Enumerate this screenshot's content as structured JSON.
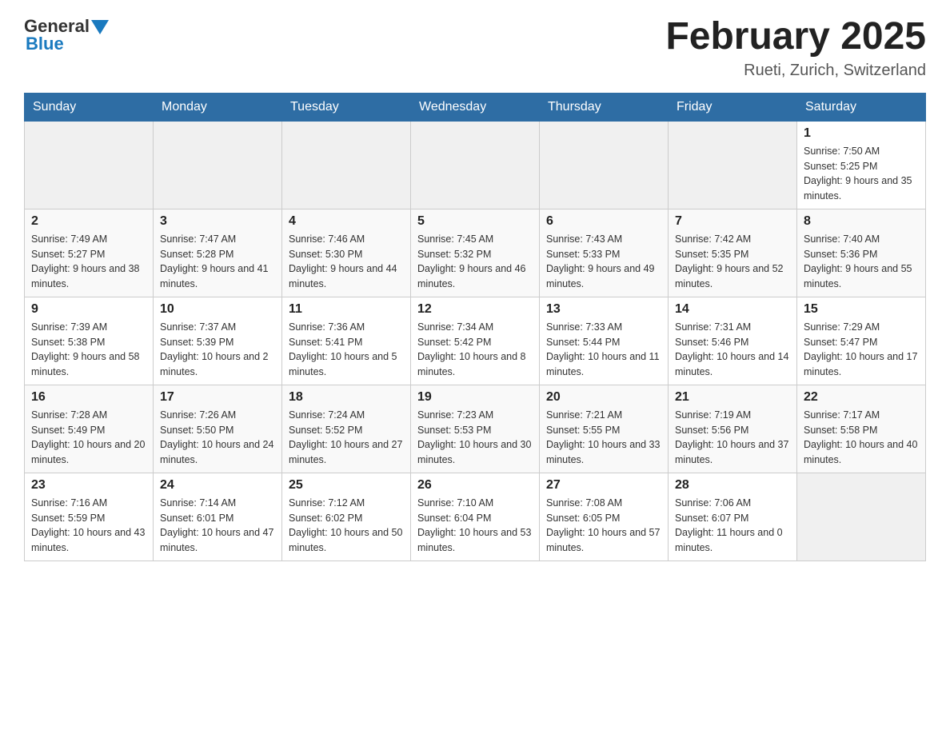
{
  "header": {
    "logo_general": "General",
    "logo_blue": "Blue",
    "title": "February 2025",
    "location": "Rueti, Zurich, Switzerland"
  },
  "days_of_week": [
    "Sunday",
    "Monday",
    "Tuesday",
    "Wednesday",
    "Thursday",
    "Friday",
    "Saturday"
  ],
  "weeks": [
    [
      {
        "day": "",
        "sunrise": "",
        "sunset": "",
        "daylight": ""
      },
      {
        "day": "",
        "sunrise": "",
        "sunset": "",
        "daylight": ""
      },
      {
        "day": "",
        "sunrise": "",
        "sunset": "",
        "daylight": ""
      },
      {
        "day": "",
        "sunrise": "",
        "sunset": "",
        "daylight": ""
      },
      {
        "day": "",
        "sunrise": "",
        "sunset": "",
        "daylight": ""
      },
      {
        "day": "",
        "sunrise": "",
        "sunset": "",
        "daylight": ""
      },
      {
        "day": "1",
        "sunrise": "Sunrise: 7:50 AM",
        "sunset": "Sunset: 5:25 PM",
        "daylight": "Daylight: 9 hours and 35 minutes."
      }
    ],
    [
      {
        "day": "2",
        "sunrise": "Sunrise: 7:49 AM",
        "sunset": "Sunset: 5:27 PM",
        "daylight": "Daylight: 9 hours and 38 minutes."
      },
      {
        "day": "3",
        "sunrise": "Sunrise: 7:47 AM",
        "sunset": "Sunset: 5:28 PM",
        "daylight": "Daylight: 9 hours and 41 minutes."
      },
      {
        "day": "4",
        "sunrise": "Sunrise: 7:46 AM",
        "sunset": "Sunset: 5:30 PM",
        "daylight": "Daylight: 9 hours and 44 minutes."
      },
      {
        "day": "5",
        "sunrise": "Sunrise: 7:45 AM",
        "sunset": "Sunset: 5:32 PM",
        "daylight": "Daylight: 9 hours and 46 minutes."
      },
      {
        "day": "6",
        "sunrise": "Sunrise: 7:43 AM",
        "sunset": "Sunset: 5:33 PM",
        "daylight": "Daylight: 9 hours and 49 minutes."
      },
      {
        "day": "7",
        "sunrise": "Sunrise: 7:42 AM",
        "sunset": "Sunset: 5:35 PM",
        "daylight": "Daylight: 9 hours and 52 minutes."
      },
      {
        "day": "8",
        "sunrise": "Sunrise: 7:40 AM",
        "sunset": "Sunset: 5:36 PM",
        "daylight": "Daylight: 9 hours and 55 minutes."
      }
    ],
    [
      {
        "day": "9",
        "sunrise": "Sunrise: 7:39 AM",
        "sunset": "Sunset: 5:38 PM",
        "daylight": "Daylight: 9 hours and 58 minutes."
      },
      {
        "day": "10",
        "sunrise": "Sunrise: 7:37 AM",
        "sunset": "Sunset: 5:39 PM",
        "daylight": "Daylight: 10 hours and 2 minutes."
      },
      {
        "day": "11",
        "sunrise": "Sunrise: 7:36 AM",
        "sunset": "Sunset: 5:41 PM",
        "daylight": "Daylight: 10 hours and 5 minutes."
      },
      {
        "day": "12",
        "sunrise": "Sunrise: 7:34 AM",
        "sunset": "Sunset: 5:42 PM",
        "daylight": "Daylight: 10 hours and 8 minutes."
      },
      {
        "day": "13",
        "sunrise": "Sunrise: 7:33 AM",
        "sunset": "Sunset: 5:44 PM",
        "daylight": "Daylight: 10 hours and 11 minutes."
      },
      {
        "day": "14",
        "sunrise": "Sunrise: 7:31 AM",
        "sunset": "Sunset: 5:46 PM",
        "daylight": "Daylight: 10 hours and 14 minutes."
      },
      {
        "day": "15",
        "sunrise": "Sunrise: 7:29 AM",
        "sunset": "Sunset: 5:47 PM",
        "daylight": "Daylight: 10 hours and 17 minutes."
      }
    ],
    [
      {
        "day": "16",
        "sunrise": "Sunrise: 7:28 AM",
        "sunset": "Sunset: 5:49 PM",
        "daylight": "Daylight: 10 hours and 20 minutes."
      },
      {
        "day": "17",
        "sunrise": "Sunrise: 7:26 AM",
        "sunset": "Sunset: 5:50 PM",
        "daylight": "Daylight: 10 hours and 24 minutes."
      },
      {
        "day": "18",
        "sunrise": "Sunrise: 7:24 AM",
        "sunset": "Sunset: 5:52 PM",
        "daylight": "Daylight: 10 hours and 27 minutes."
      },
      {
        "day": "19",
        "sunrise": "Sunrise: 7:23 AM",
        "sunset": "Sunset: 5:53 PM",
        "daylight": "Daylight: 10 hours and 30 minutes."
      },
      {
        "day": "20",
        "sunrise": "Sunrise: 7:21 AM",
        "sunset": "Sunset: 5:55 PM",
        "daylight": "Daylight: 10 hours and 33 minutes."
      },
      {
        "day": "21",
        "sunrise": "Sunrise: 7:19 AM",
        "sunset": "Sunset: 5:56 PM",
        "daylight": "Daylight: 10 hours and 37 minutes."
      },
      {
        "day": "22",
        "sunrise": "Sunrise: 7:17 AM",
        "sunset": "Sunset: 5:58 PM",
        "daylight": "Daylight: 10 hours and 40 minutes."
      }
    ],
    [
      {
        "day": "23",
        "sunrise": "Sunrise: 7:16 AM",
        "sunset": "Sunset: 5:59 PM",
        "daylight": "Daylight: 10 hours and 43 minutes."
      },
      {
        "day": "24",
        "sunrise": "Sunrise: 7:14 AM",
        "sunset": "Sunset: 6:01 PM",
        "daylight": "Daylight: 10 hours and 47 minutes."
      },
      {
        "day": "25",
        "sunrise": "Sunrise: 7:12 AM",
        "sunset": "Sunset: 6:02 PM",
        "daylight": "Daylight: 10 hours and 50 minutes."
      },
      {
        "day": "26",
        "sunrise": "Sunrise: 7:10 AM",
        "sunset": "Sunset: 6:04 PM",
        "daylight": "Daylight: 10 hours and 53 minutes."
      },
      {
        "day": "27",
        "sunrise": "Sunrise: 7:08 AM",
        "sunset": "Sunset: 6:05 PM",
        "daylight": "Daylight: 10 hours and 57 minutes."
      },
      {
        "day": "28",
        "sunrise": "Sunrise: 7:06 AM",
        "sunset": "Sunset: 6:07 PM",
        "daylight": "Daylight: 11 hours and 0 minutes."
      },
      {
        "day": "",
        "sunrise": "",
        "sunset": "",
        "daylight": ""
      }
    ]
  ]
}
